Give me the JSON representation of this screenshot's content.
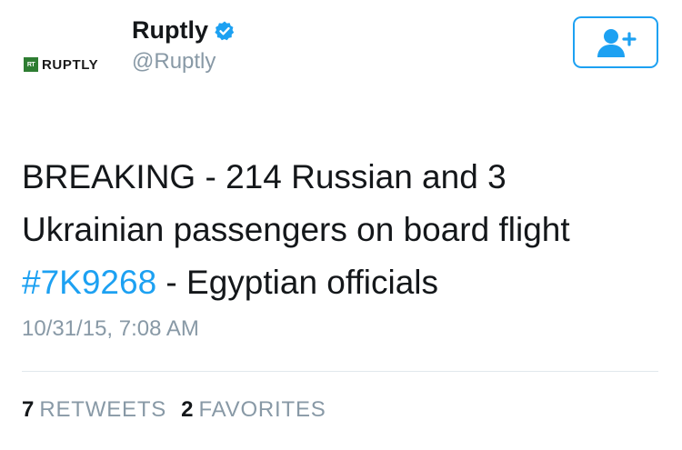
{
  "user": {
    "display_name": "Ruptly",
    "handle": "@Ruptly",
    "avatar_badge": "RT",
    "avatar_text": "RUPTLY",
    "verified": true
  },
  "follow_button": {
    "icon": "add-user-icon",
    "accent_color": "#1da1f2"
  },
  "tweet": {
    "text_line_1": "BREAKING - 214 Russian and 3",
    "text_line_2": "Ukrainian passengers on board flight",
    "hashtag": "#7K9268",
    "text_after_hashtag": " - Egyptian officials",
    "timestamp": "10/31/15, 7:08 AM"
  },
  "stats": {
    "retweets_count": "7",
    "retweets_label": "RETWEETS",
    "favorites_count": "2",
    "favorites_label": "FAVORITES"
  },
  "colors": {
    "text": "#14171a",
    "secondary": "#8899a6",
    "link": "#1da1f2",
    "verified_badge": "#1da1f2",
    "divider": "#e1e8ed"
  }
}
